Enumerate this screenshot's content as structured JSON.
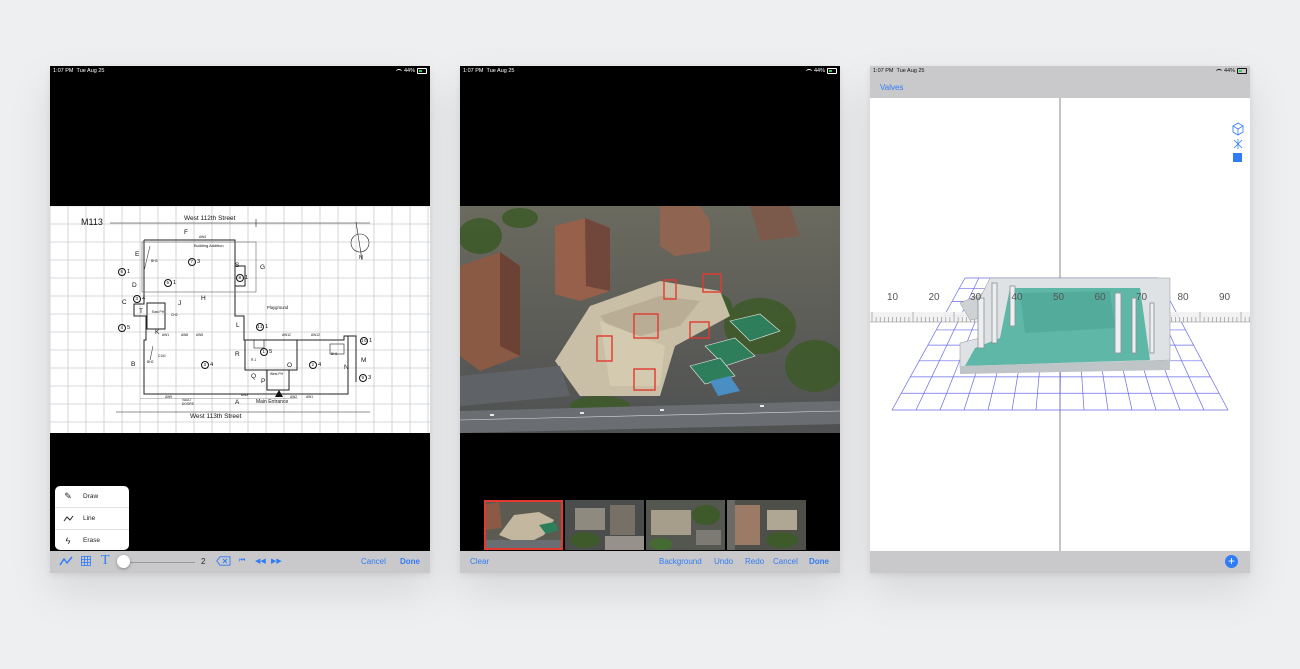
{
  "panels": [
    {
      "status": {
        "time": "1:07 PM",
        "date": "Tue Aug 25",
        "battery": "44%"
      },
      "floorplan": {
        "label": "M113",
        "north_street": "West 112th Street",
        "south_street": "West 113th Street",
        "compass": "N",
        "building_addition": "Building Addition",
        "playground": "Playground",
        "main_entrance": "Main Entrance",
        "vault_doors": "VAULT DOORS",
        "letters": [
          "E",
          "F",
          "G",
          "S",
          "H",
          "C",
          "D",
          "T",
          "J",
          "K",
          "L",
          "R",
          "B",
          "O",
          "N",
          "M",
          "Q",
          "P",
          "A"
        ],
        "markers": [
          "6 1",
          "7 3",
          "5 1",
          "8 1",
          "3 4",
          "4 5",
          "11 1",
          "10 1",
          "1 5",
          "3 4",
          "2 4",
          "9 3"
        ],
        "small_labels": [
          "AW4",
          "BH3",
          "CH2",
          "East PH",
          "AW1",
          "AW8",
          "AW5",
          "AW12",
          "AW12",
          "C1#1",
          "BH2",
          "BH1",
          "R-1",
          "West PH",
          "AW3",
          "AW2",
          "AW1",
          "AW9"
        ]
      },
      "tool_menu": [
        {
          "icon": "pencil-icon",
          "label": "Draw"
        },
        {
          "icon": "line-icon",
          "label": "Line"
        },
        {
          "icon": "eraser-icon",
          "label": "Erase"
        }
      ],
      "toolbar": {
        "stroke_value": "2",
        "cancel": "Cancel",
        "done": "Done"
      }
    },
    {
      "status": {
        "time": "1:07 PM",
        "date": "Tue Aug 25",
        "battery": "44%"
      },
      "toolbar": {
        "clear": "Clear",
        "background": "Background",
        "undo": "Undo",
        "redo": "Redo",
        "cancel": "Cancel",
        "done": "Done"
      },
      "thumbnails": 4,
      "selected_thumbnail": 1
    },
    {
      "status": {
        "time": "1:07 PM",
        "date": "Tue Aug 25",
        "battery": "44%"
      },
      "nav": {
        "back": "Valves"
      },
      "ruler": {
        "labels": [
          "10",
          "20",
          "30",
          "40",
          "50",
          "60",
          "70",
          "80",
          "90"
        ]
      },
      "colors": {
        "accent": "#2f7cf6",
        "model": "#5fb8a7"
      }
    }
  ]
}
